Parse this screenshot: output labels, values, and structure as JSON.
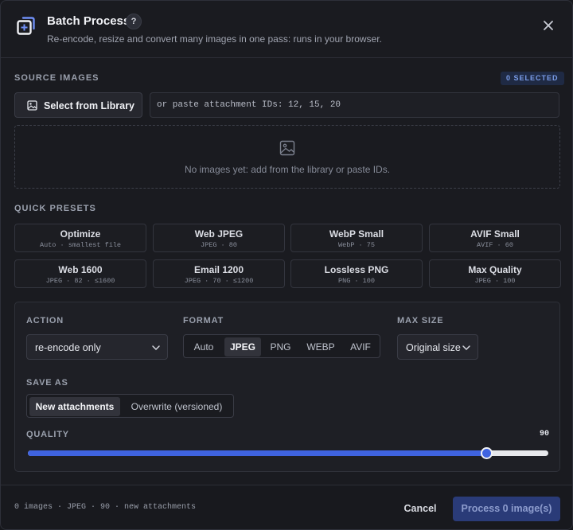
{
  "header": {
    "title": "Batch Process",
    "help": "?",
    "subtitle": "Re-encode, resize and convert many images in one pass: runs in your browser."
  },
  "source": {
    "label": "SOURCE IMAGES",
    "badge": "0 SELECTED",
    "library_button": "Select from Library",
    "ids_placeholder": "or paste attachment IDs: 12, 15, 20",
    "ids_value": "",
    "empty_message": "No images yet: add from the library or paste IDs."
  },
  "presets": {
    "label": "QUICK PRESETS",
    "items": [
      {
        "name": "Optimize",
        "desc": "Auto · smallest file"
      },
      {
        "name": "Web JPEG",
        "desc": "JPEG · 80"
      },
      {
        "name": "WebP Small",
        "desc": "WebP · 75"
      },
      {
        "name": "AVIF Small",
        "desc": "AVIF · 60"
      },
      {
        "name": "Web 1600",
        "desc": "JPEG · 82 · ≤1600"
      },
      {
        "name": "Email 1200",
        "desc": "JPEG · 70 · ≤1200"
      },
      {
        "name": "Lossless PNG",
        "desc": "PNG · 100"
      },
      {
        "name": "Max Quality",
        "desc": "JPEG · 100"
      }
    ]
  },
  "options": {
    "action_label": "ACTION",
    "action_value": "re-encode only",
    "format_label": "FORMAT",
    "formats": [
      "Auto",
      "JPEG",
      "PNG",
      "WEBP",
      "AVIF"
    ],
    "format_selected": "JPEG",
    "maxsize_label": "MAX SIZE",
    "maxsize_value": "Original size",
    "saveas_label": "SAVE AS",
    "saveas_options": [
      "New attachments",
      "Overwrite (versioned)"
    ],
    "saveas_selected": "New attachments",
    "quality_label": "QUALITY",
    "quality_value": "90",
    "quality_fraction": 0.88
  },
  "footer": {
    "summary": "0 images · JPEG · 90 · new attachments",
    "cancel": "Cancel",
    "process": "Process 0 image(s)"
  },
  "colors": {
    "accent": "#3f63e0",
    "badge_text": "#7b9eea",
    "background": "#1a1b20"
  }
}
